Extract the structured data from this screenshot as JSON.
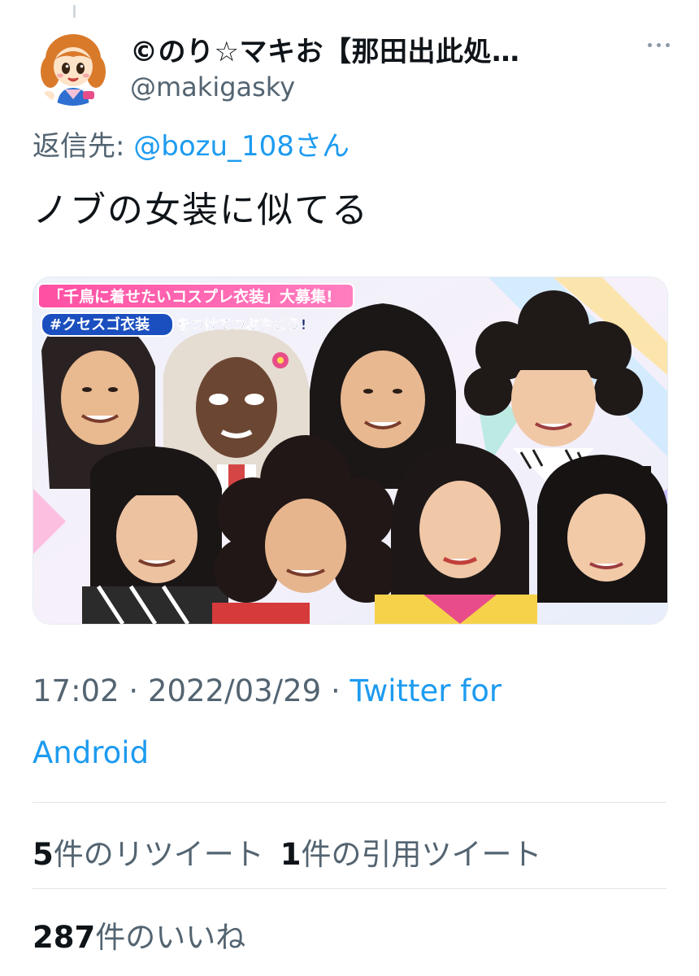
{
  "tweet": {
    "author": {
      "display_name": "©のり☆マキお【那田出此処…",
      "handle": "@makigasky",
      "avatar_icon": "cartoon-girl-avatar"
    },
    "reply_to": {
      "prefix": "返信先: ",
      "mention": "@bozu_108さん"
    },
    "text": "ノブの女装に似てる",
    "media": {
      "banner_line1": "「千鳥に着せたいコスプレ衣装」大募集!",
      "hashtag": "#クセスゴ衣装",
      "banner_line2_suffix": "をつけてつぶやこう!"
    },
    "timestamp": {
      "time": "17:02",
      "separator": " · ",
      "date": "2022/03/29",
      "separator2": " · ",
      "source_part1": "Twitter for",
      "source_part2": "Android"
    },
    "stats": {
      "retweets_count": "5",
      "retweets_label": "件のリツイート",
      "quotes_count": "1",
      "quotes_label": "件の引用ツイート",
      "likes_count": "287",
      "likes_label": "件のいいね"
    },
    "colors": {
      "link": "#1d9bf0",
      "secondary_text": "#536471",
      "primary_text": "#0f1419"
    }
  }
}
